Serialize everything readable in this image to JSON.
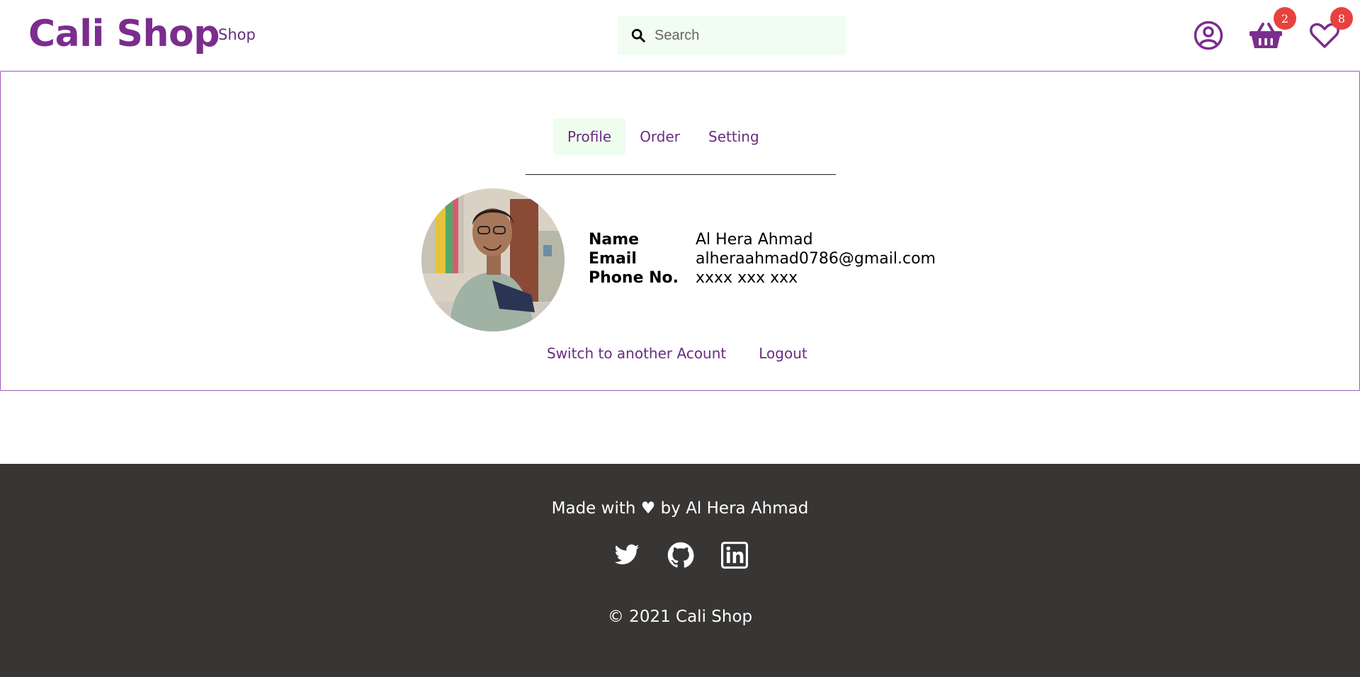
{
  "header": {
    "logo": "Cali Shop",
    "nav": {
      "shop_label": "Shop"
    },
    "search": {
      "placeholder": "Search"
    },
    "icons": {
      "account": "user-circle-icon",
      "cart": "basket-icon",
      "wishlist": "heart-icon"
    },
    "cart_count": "2",
    "wishlist_count": "8",
    "accent_color": "#7b2d8e"
  },
  "profile": {
    "tabs": [
      {
        "label": "Profile",
        "active": true
      },
      {
        "label": "Order",
        "active": false
      },
      {
        "label": "Setting",
        "active": false
      }
    ],
    "fields": [
      {
        "key": "Name",
        "value": "Al Hera Ahmad"
      },
      {
        "key": "Email",
        "value": "alheraahmad0786@gmail.com"
      },
      {
        "key": "Phone No.",
        "value": "xxxx xxx xxx"
      }
    ],
    "actions": {
      "switch_label": "Switch to another Acount",
      "logout_label": "Logout"
    }
  },
  "footer": {
    "made_with": "Made with ♥ by Al Hera Ahmad",
    "social_icons": [
      "twitter-icon",
      "github-icon",
      "linkedin-icon"
    ],
    "copyright": "© 2021 Cali Shop",
    "background": "#383634"
  }
}
